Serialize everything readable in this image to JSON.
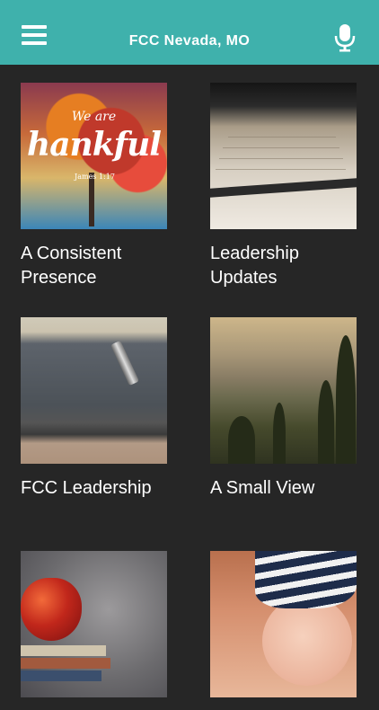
{
  "header": {
    "title": "FCC Nevada, MO",
    "menu_icon": "hamburger-menu-icon",
    "mic_icon": "microphone-icon",
    "background": "#3fb1ac"
  },
  "cards": [
    {
      "label": "A Consistent Presence",
      "thumb_text": [
        "We are",
        "hankful",
        "James 1:17"
      ]
    },
    {
      "label": "Leadership Updates"
    },
    {
      "label": "FCC Leadership"
    },
    {
      "label": "A Small View"
    },
    {
      "label": ""
    },
    {
      "label": ""
    }
  ]
}
